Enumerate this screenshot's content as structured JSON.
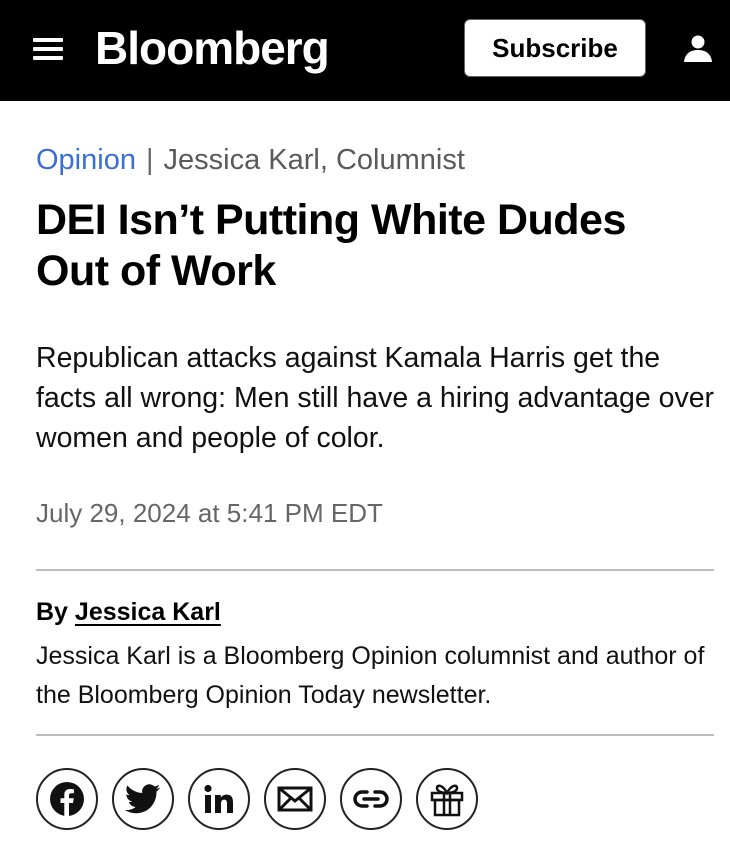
{
  "header": {
    "logo": "Bloomberg",
    "subscribe_label": "Subscribe",
    "menu_icon": "hamburger-menu-icon",
    "account_icon": "user-icon"
  },
  "article": {
    "section": "Opinion",
    "separator": "|",
    "author_line": "Jessica Karl, Columnist",
    "headline": "DEI Isn’t Putting White Dudes Out of Work",
    "dek": "Republican attacks against Kamala Harris get the facts all wrong: Men still have a hiring advantage over women and people of color.",
    "timestamp": "July 29, 2024 at 5:41 PM EDT",
    "byline_prefix": "By",
    "byline_name": "Jessica Karl",
    "author_bio": "Jessica Karl is a Bloomberg Opinion columnist and author of the Bloomberg Opinion Today newsletter."
  },
  "share": {
    "icons": [
      "facebook-icon",
      "twitter-icon",
      "linkedin-icon",
      "email-icon",
      "link-icon",
      "gift-icon"
    ]
  },
  "colors": {
    "header_bg": "#000000",
    "section_link": "#3a6fd8",
    "muted_text": "#666666"
  }
}
